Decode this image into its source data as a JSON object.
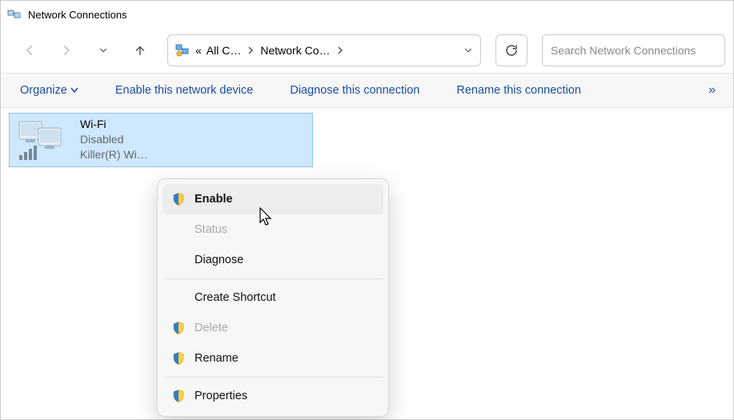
{
  "window": {
    "title": "Network Connections"
  },
  "breadcrumb": {
    "root_prefix": "«",
    "crumb1": "All C…",
    "crumb2": "Network Co…"
  },
  "search": {
    "placeholder": "Search Network Connections"
  },
  "toolbar": {
    "organize": "Organize",
    "enable_device": "Enable this network device",
    "diagnose": "Diagnose this connection",
    "rename": "Rename this connection",
    "overflow": "»"
  },
  "item": {
    "name": "Wi-Fi",
    "status": "Disabled",
    "adapter": "Killer(R) Wi…"
  },
  "context_menu": {
    "enable": "Enable",
    "status": "Status",
    "diagnose": "Diagnose",
    "create_shortcut": "Create Shortcut",
    "delete": "Delete",
    "rename": "Rename",
    "properties": "Properties"
  }
}
